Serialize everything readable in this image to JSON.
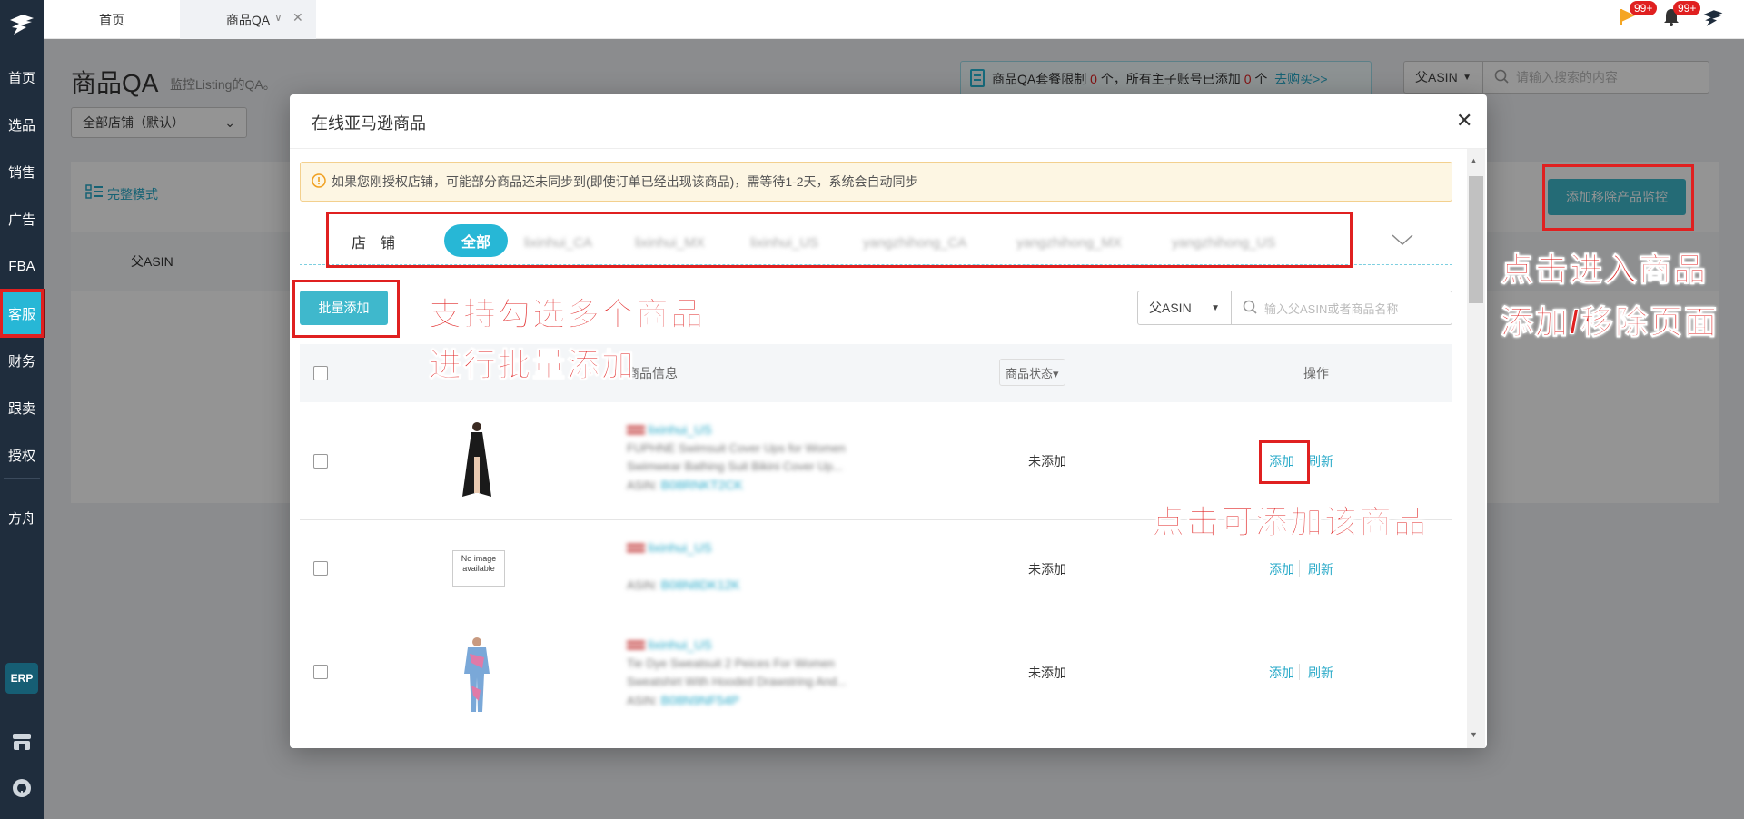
{
  "sidebar": {
    "items": [
      "首页",
      "选品",
      "销售",
      "广告",
      "FBA",
      "客服",
      "财务",
      "跟卖",
      "授权",
      "方舟"
    ],
    "active_index": 5,
    "erp_label": "ERP"
  },
  "topbar": {
    "tabs": [
      {
        "label": "首页"
      },
      {
        "label": "商品QA"
      }
    ],
    "badges": [
      "99+",
      "99+"
    ]
  },
  "page": {
    "title": "商品QA",
    "subtitle": "监控Listing的QA。",
    "store_select": "全部店铺（默认）",
    "limit_text_prefix": "商品QA套餐限制",
    "limit_count": "0",
    "limit_text_mid": "个，所有主子账号已添加",
    "added_count": "0",
    "limit_text_suffix": "个",
    "buy_link": "去购买>>",
    "search_type": "父ASIN",
    "search_placeholder": "请输入搜索的内容",
    "full_mode": "完整模式",
    "col_parent_asin": "父ASIN",
    "add_remove_button": "添加移除产品监控"
  },
  "modal": {
    "title": "在线亚马逊商品",
    "notice": "如果您刚授权店铺，可能部分商品还未同步到(即使订单已经出现该商品)，需等待1-2天，系统会自动同步",
    "store_label": "店　铺",
    "stores": [
      "全部",
      "lixinhui_CA",
      "lixinhui_MX",
      "lixinhui_US",
      "yangzhihong_CA",
      "yangzhihong_MX",
      "yangzhihong_US"
    ],
    "batch_add": "批量添加",
    "search_type": "父ASIN",
    "search_placeholder": "输入父ASIN或者商品名称",
    "headers": {
      "info": "商品信息",
      "status": "商品状态▾",
      "action": "操作"
    },
    "rows": [
      {
        "store": "lixinhui_US",
        "title1": "FUPHNE Swimsuit Cover Ups for Women",
        "title2": "Swimwear Bathing Suit Bikini Cover Up...",
        "asin_label": "ASIN:",
        "asin": "B08RNKT2CK",
        "status": "未添加",
        "add": "添加",
        "refresh": "刷新",
        "image": "dress"
      },
      {
        "store": "lixinhui_US",
        "title1": "",
        "title2": "",
        "asin_label": "ASIN:",
        "asin": "B08N8DK12K",
        "status": "未添加",
        "add": "添加",
        "refresh": "刷新",
        "image": "no-image",
        "no_image_line1": "No image",
        "no_image_line2": "available"
      },
      {
        "store": "lixinhui_US",
        "title1": "Tie Dye Sweatsuit 2 Peices For Women",
        "title2": "Sweatshirt With Hooded Drawstring And...",
        "asin_label": "ASIN:",
        "asin": "B08N9NF54P",
        "status": "未添加",
        "add": "添加",
        "refresh": "刷新",
        "image": "tracksuit"
      }
    ]
  },
  "annotations": {
    "batch": [
      "支持勾选多个商品",
      "进行批量添加"
    ],
    "add": "点击可添加该商品",
    "enter": [
      "点击进入商品",
      "添加/移除页面"
    ]
  },
  "colors": {
    "sidebar": "#1f2d3d",
    "accent": "#27b7d6",
    "annotation_red": "#e02020"
  }
}
